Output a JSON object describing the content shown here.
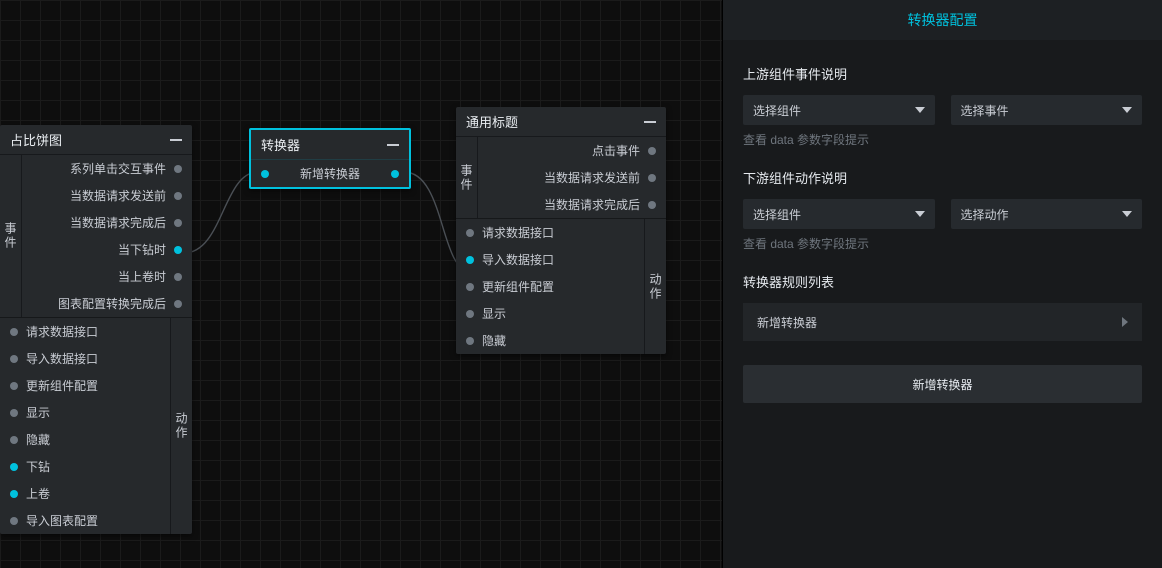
{
  "canvas": {
    "pieNode": {
      "title": "占比饼图",
      "eventsLabel": "事件",
      "events": [
        {
          "label": "系列单击交互事件",
          "active": false
        },
        {
          "label": "当数据请求发送前",
          "active": false
        },
        {
          "label": "当数据请求完成后",
          "active": false
        },
        {
          "label": "当下钻时",
          "active": true
        },
        {
          "label": "当上卷时",
          "active": false
        },
        {
          "label": "图表配置转换完成后",
          "active": false
        }
      ],
      "actionsLabel": "动作",
      "actions": [
        {
          "label": "请求数据接口",
          "active": false
        },
        {
          "label": "导入数据接口",
          "active": false
        },
        {
          "label": "更新组件配置",
          "active": false
        },
        {
          "label": "显示",
          "active": false
        },
        {
          "label": "隐藏",
          "active": false
        },
        {
          "label": "下钻",
          "active": true
        },
        {
          "label": "上卷",
          "active": true
        },
        {
          "label": "导入图表配置",
          "active": false
        }
      ]
    },
    "converterNode": {
      "title": "转换器",
      "rowLabel": "新增转换器"
    },
    "titleNode": {
      "title": "通用标题",
      "eventsLabel": "事件",
      "events": [
        {
          "label": "点击事件",
          "active": false
        },
        {
          "label": "当数据请求发送前",
          "active": false
        },
        {
          "label": "当数据请求完成后",
          "active": false
        }
      ],
      "actionsLabel": "动作",
      "actions": [
        {
          "label": "请求数据接口",
          "active": false
        },
        {
          "label": "导入数据接口",
          "active": true
        },
        {
          "label": "更新组件配置",
          "active": false
        },
        {
          "label": "显示",
          "active": false
        },
        {
          "label": "隐藏",
          "active": false
        }
      ]
    }
  },
  "panel": {
    "title": "转换器配置",
    "upstream": {
      "title": "上游组件事件说明",
      "componentPlaceholder": "选择组件",
      "eventPlaceholder": "选择事件",
      "hint": "查看 data 参数字段提示"
    },
    "downstream": {
      "title": "下游组件动作说明",
      "componentPlaceholder": "选择组件",
      "actionPlaceholder": "选择动作",
      "hint": "查看 data 参数字段提示"
    },
    "rules": {
      "title": "转换器规则列表",
      "items": [
        "新增转换器"
      ],
      "addButton": "新增转换器"
    }
  }
}
